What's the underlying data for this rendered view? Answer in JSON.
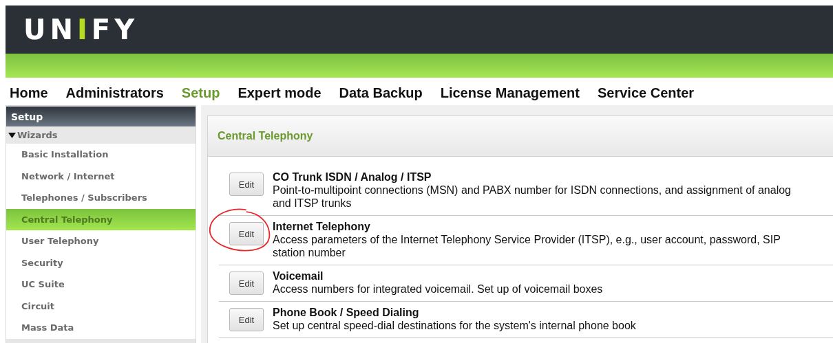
{
  "logo": {
    "before": "UN",
    "accent": "I",
    "after": "FY"
  },
  "nav": [
    {
      "label": "Home",
      "selected": false
    },
    {
      "label": "Administrators",
      "selected": false
    },
    {
      "label": "Setup",
      "selected": true
    },
    {
      "label": "Expert mode",
      "selected": false
    },
    {
      "label": "Data Backup",
      "selected": false
    },
    {
      "label": "License Management",
      "selected": false
    },
    {
      "label": "Service Center",
      "selected": false
    }
  ],
  "sidebar": {
    "title": "Setup",
    "group": {
      "label": "Wizards",
      "expanded": true,
      "items": [
        {
          "label": "Basic Installation",
          "selected": false
        },
        {
          "label": "Network / Internet",
          "selected": false
        },
        {
          "label": "Telephones / Subscribers",
          "selected": false
        },
        {
          "label": "Central Telephony",
          "selected": true
        },
        {
          "label": "User Telephony",
          "selected": false
        },
        {
          "label": "Security",
          "selected": false
        },
        {
          "label": "UC Suite",
          "selected": false
        },
        {
          "label": "Circuit",
          "selected": false
        },
        {
          "label": "Mass Data",
          "selected": false
        }
      ]
    }
  },
  "panel": {
    "title": "Central Telephony",
    "rows": [
      {
        "button": "Edit",
        "title": "CO Trunk ISDN / Analog / ITSP",
        "description": "Point-to-multipoint connections (MSN) and PABX number for ISDN connections, and assignment of analog and ITSP trunks",
        "circled": false
      },
      {
        "button": "Edit",
        "title": "Internet Telephony",
        "description": "Access parameters of the Internet Telephony Service Provider (ITSP), e.g., user account, password, SIP station number",
        "circled": true
      },
      {
        "button": "Edit",
        "title": "Voicemail",
        "description": "Access numbers for integrated voicemail. Set up of voicemail boxes",
        "circled": false
      },
      {
        "button": "Edit",
        "title": "Phone Book / Speed Dialing",
        "description": "Set up central speed-dial destinations for the system's internal phone book",
        "circled": false
      }
    ]
  }
}
